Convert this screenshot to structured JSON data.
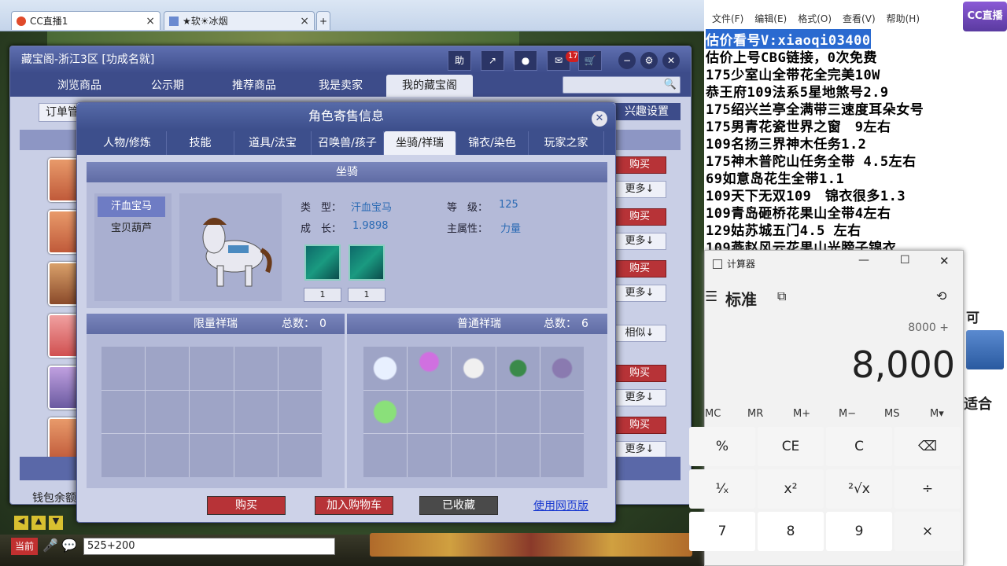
{
  "browser": {
    "tabs": [
      {
        "label": "CC直播1",
        "close": "×"
      },
      {
        "label": "★软☀冰烟",
        "close": "×"
      }
    ],
    "new_tab": "+"
  },
  "game_window": {
    "title": "藏宝阁-浙江3区 [功成名就]",
    "help_label": "助",
    "mail_badge": "17",
    "nav_tabs": [
      "浏览商品",
      "公示期",
      "推荐商品",
      "我是卖家",
      "我的藏宝阁"
    ],
    "active_nav": "我的藏宝阁",
    "order_label": "订单管",
    "interest_label": "兴趣设置",
    "wallet_label": "钱包余额",
    "list_buttons": [
      {
        "buy": "购买",
        "more": "更多↓"
      },
      {
        "buy": "购买",
        "more": "更多↓"
      },
      {
        "buy": "购买",
        "more": "更多↓"
      },
      {
        "similar": "相似↓"
      },
      {
        "buy": "购买",
        "more": "更多↓"
      },
      {
        "buy": "购买",
        "more": "更多↓"
      }
    ]
  },
  "dialog": {
    "title": "角色寄售信息",
    "close": "✕",
    "tabs": [
      "人物/修炼",
      "技能",
      "道具/法宝",
      "召唤兽/孩子",
      "坐骑/祥瑞",
      "锦衣/染色",
      "玩家之家"
    ],
    "active_tab": "坐骑/祥瑞",
    "mount_section": "坐骑",
    "mount_list": [
      "汗血宝马",
      "宝贝葫芦"
    ],
    "selected_mount": "汗血宝马",
    "fields": {
      "type_label": "类　型：",
      "type_value": "汗血宝马",
      "level_label": "等　级：",
      "level_value": "125",
      "growth_label": "成　长：",
      "growth_value": "1.9898",
      "attr_label": "主属性：",
      "attr_value": "力量"
    },
    "skill_counts": [
      "1",
      "1"
    ],
    "limited": {
      "title": "限量祥瑞",
      "total_label": "总数：",
      "total": "0"
    },
    "normal": {
      "title": "普通祥瑞",
      "total_label": "总数：",
      "total": "6"
    },
    "footer": {
      "buy": "购买",
      "add_cart": "加入购物车",
      "favorited": "已收藏",
      "web_version": "使用网页版"
    }
  },
  "game_bar": {
    "channel": "当前",
    "chat_input": "525+200"
  },
  "notepad": {
    "menu": [
      "文件(F)",
      "编辑(E)",
      "格式(O)",
      "查看(V)",
      "帮助(H)"
    ],
    "lines": [
      "估价看号V:xiaoqi03400",
      "估价上号CBG链接，0次免费",
      "175少室山全带花全完美10W",
      "恭王府109法系5星地煞号2.9",
      "175绍兴兰亭全满带三速度耳朵女号",
      "175男青花瓷世界之窗　9左右",
      "109名扬三界神木任务1.2",
      "175神木普陀山任务全带 4.5左右",
      "69如意岛花生全带1.1",
      "109天下无双109　锦衣很多1.3",
      "109青岛砸桥花果山全带4左右",
      "129姑苏城五门4.5 左右",
      "109燕赵风云花果山光膀子锦衣"
    ],
    "side_text": "适合",
    "side_text2": "可"
  },
  "calculator": {
    "title": "计算器",
    "mode": "标准",
    "expression": "8000 +",
    "display": "8,000",
    "memory": [
      "MC",
      "MR",
      "M+",
      "M−",
      "MS",
      "M▾"
    ],
    "keys": [
      [
        "%",
        "CE",
        "C",
        "⌫"
      ],
      [
        "¹⁄ₓ",
        "x²",
        "²√x",
        "÷"
      ],
      [
        "7",
        "8",
        "9",
        "×"
      ]
    ]
  },
  "stream_logo": "CC直播"
}
